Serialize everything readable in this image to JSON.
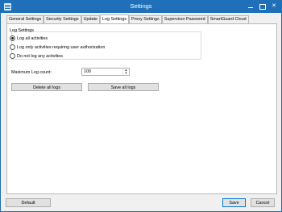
{
  "window": {
    "title": "Settings",
    "controls": {
      "minimize": "",
      "close": "✕"
    }
  },
  "tabs": [
    {
      "label": "General Settings",
      "active": false
    },
    {
      "label": "Security Settings",
      "active": false
    },
    {
      "label": "Update",
      "active": false
    },
    {
      "label": "Log Settings",
      "active": true
    },
    {
      "label": "Proxy Settings",
      "active": false
    },
    {
      "label": "Supervisor Password",
      "active": false
    },
    {
      "label": "SmartGuard Cloud",
      "active": false
    }
  ],
  "log_settings": {
    "group_title": "Log Settings",
    "options": [
      {
        "label": "Log all activities",
        "checked": true
      },
      {
        "label": "Log only activities requiring user authorization",
        "checked": false
      },
      {
        "label": "Do not log any activities",
        "checked": false
      }
    ],
    "max_log_count_label": "Maximum Log count:",
    "max_log_count_value": "100",
    "spin_up": "▲",
    "spin_down": "▼",
    "delete_all_label": "Delete all logs",
    "save_all_label": "Save all logs"
  },
  "footer": {
    "default_label": "Default",
    "save_label": "Save",
    "cancel_label": "Cancel"
  },
  "colors": {
    "titlebar": "#1f70b8",
    "primary_border": "#0078d7"
  }
}
